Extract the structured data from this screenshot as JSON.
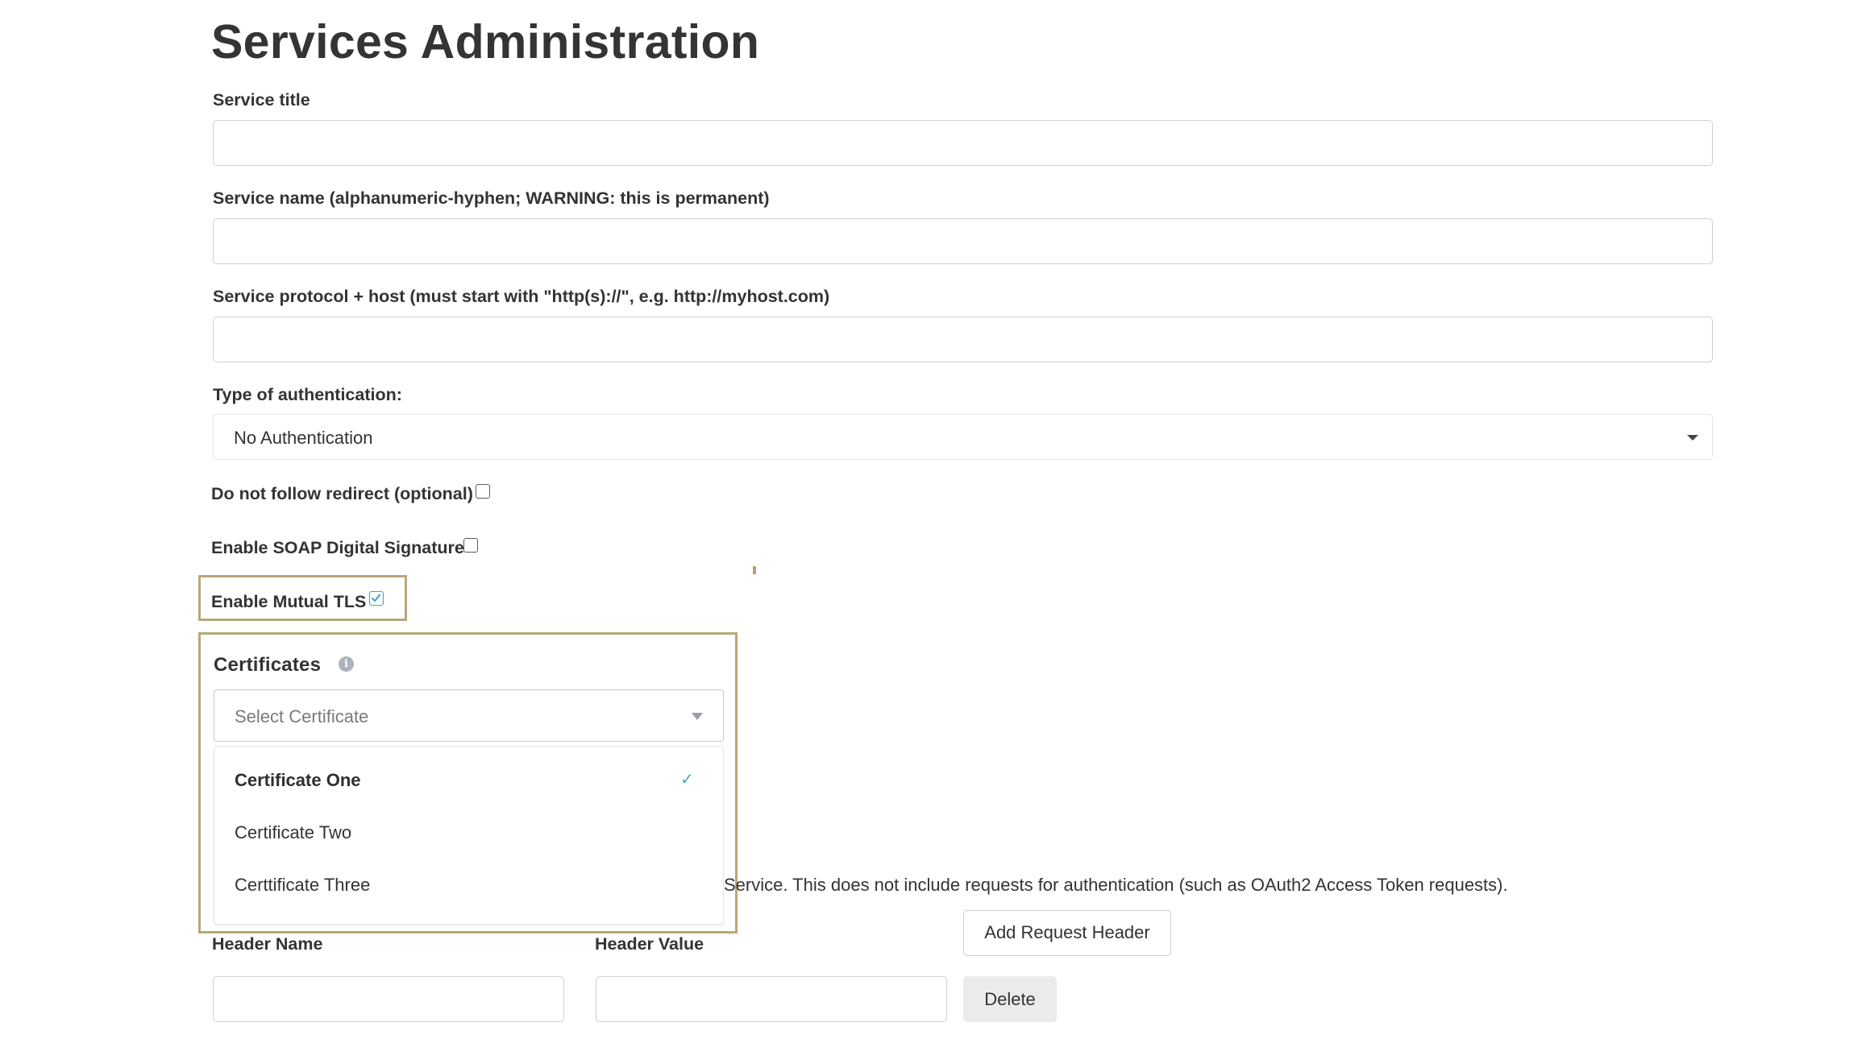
{
  "page": {
    "title": "Services Administration"
  },
  "form": {
    "service_title": {
      "label": "Service title",
      "value": ""
    },
    "service_name": {
      "label": "Service name (alphanumeric-hyphen; WARNING: this is permanent)",
      "value": ""
    },
    "service_host": {
      "label": "Service protocol + host (must start with \"http(s)://\", e.g. http://myhost.com)",
      "value": ""
    },
    "auth_type": {
      "label": "Type of authentication:",
      "selected": "No Authentication"
    },
    "no_redirect": {
      "label": "Do not follow redirect (optional)",
      "checked": false
    },
    "soap_signature": {
      "label": "Enable SOAP Digital Signature",
      "checked": false
    },
    "mutual_tls": {
      "label": "Enable Mutual TLS",
      "checked": true
    }
  },
  "certificates": {
    "title": "Certificates",
    "info_icon": "info-icon",
    "placeholder": "Select Certificate",
    "options": [
      {
        "label": "Certificate One",
        "selected": true
      },
      {
        "label": "Certificate Two",
        "selected": false
      },
      {
        "label": "Certtificate Three",
        "selected": false
      }
    ]
  },
  "request_headers": {
    "description_fragment": "Service. This does not include requests for authentication (such as OAuth2 Access Token requests).",
    "add_button": "Add Request Header",
    "name_label": "Header Name",
    "value_label": "Header Value",
    "name_value": "",
    "value_value": "",
    "delete_button": "Delete"
  },
  "colors": {
    "highlight_frame": "#b8a879",
    "check_accent": "#49a8b8",
    "text": "#333333"
  }
}
